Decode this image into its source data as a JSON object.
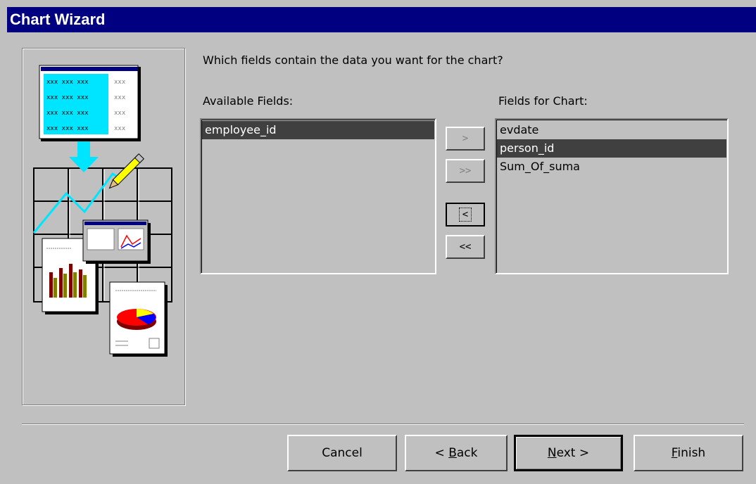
{
  "window": {
    "title": "Chart Wizard"
  },
  "prompt": "Which fields contain the data you want for the chart?",
  "available": {
    "label": "Available Fields:",
    "items": [
      "employee_id"
    ]
  },
  "chart_fields": {
    "label": "Fields for Chart:",
    "items": [
      "evdate",
      "person_id",
      "Sum_Of_suma"
    ]
  },
  "move_buttons": {
    "add_one": ">",
    "add_all": ">>",
    "remove_one": "<",
    "remove_all": "<<"
  },
  "footer": {
    "cancel": "Cancel",
    "back_prefix": "< ",
    "back_u": "B",
    "back_rest": "ack",
    "next_u": "N",
    "next_rest": "ext >",
    "finish_u": "F",
    "finish_rest": "inish"
  },
  "colors": {
    "title_bg": "#000080",
    "face": "#c0c0c0",
    "highlight": "#000080",
    "accent_cyan": "#00ffff"
  }
}
